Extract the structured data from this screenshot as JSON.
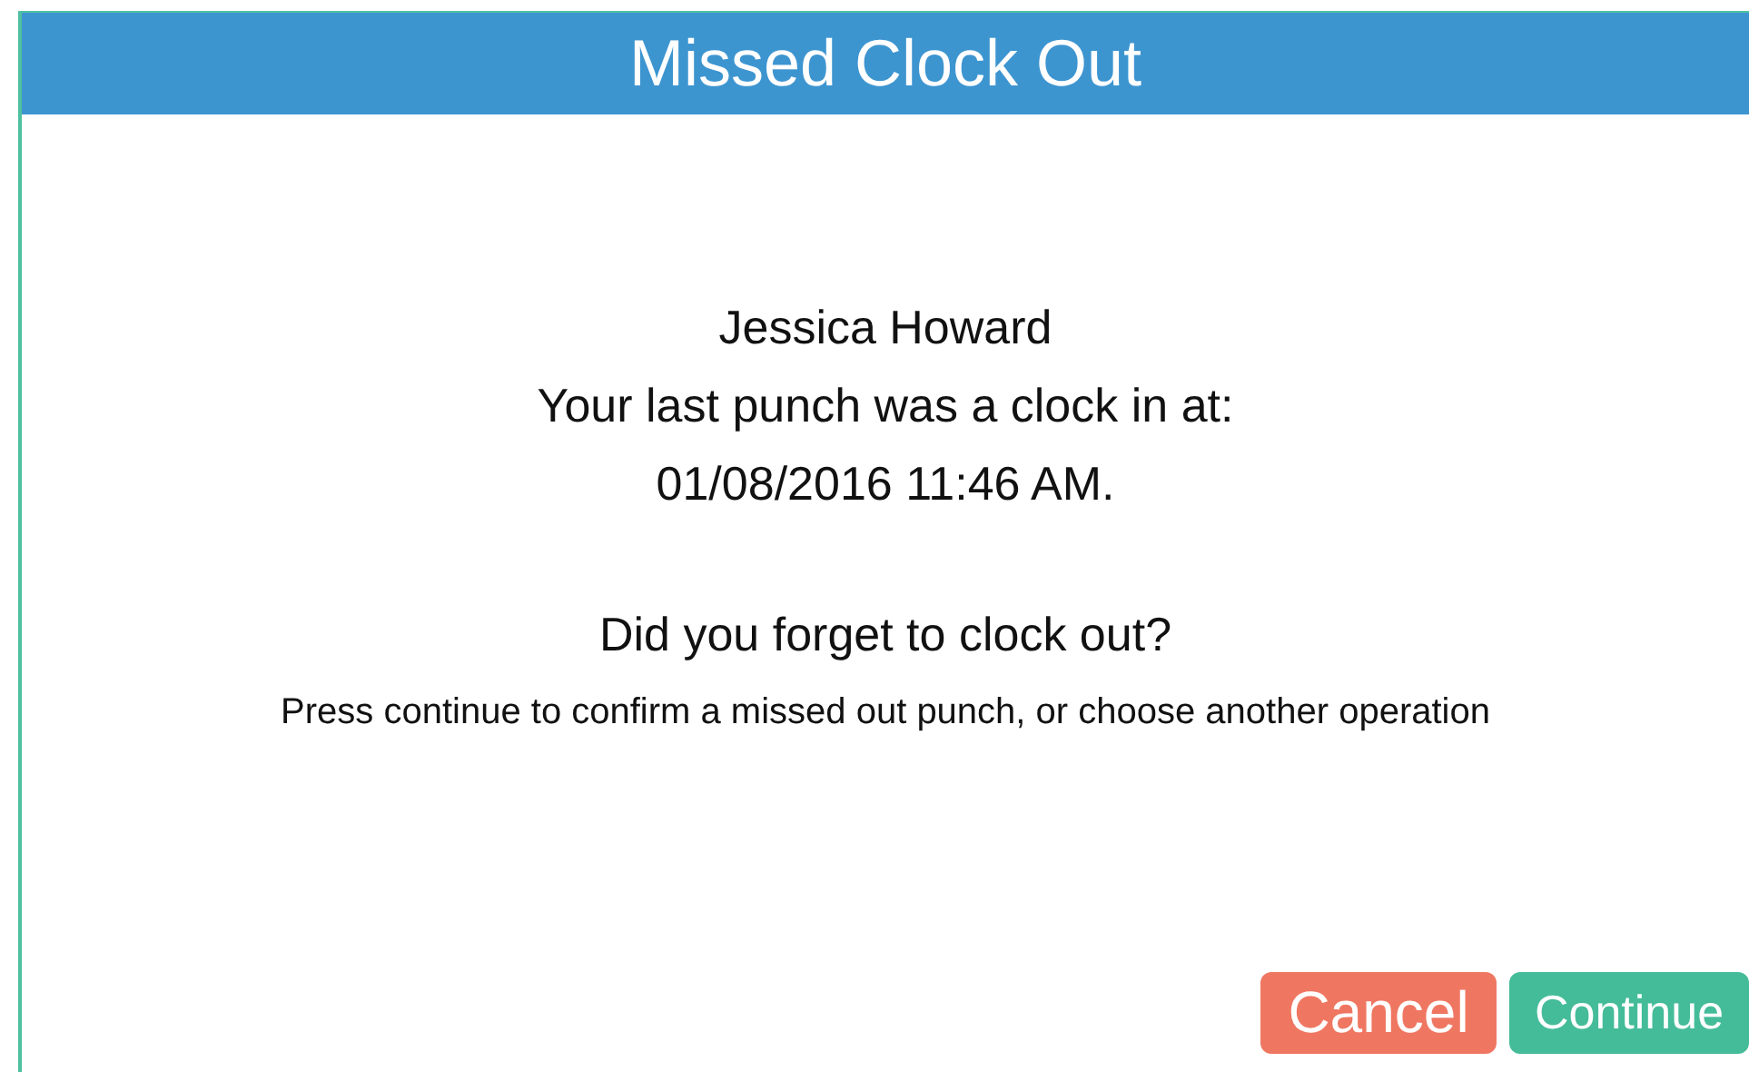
{
  "dialog": {
    "title": "Missed Clock Out",
    "employee": "Jessica Howard",
    "last_punch": "Your last punch was a clock in at:",
    "punch_time": "01/08/2016 11:46 AM.",
    "question": "Did you forget to clock out?",
    "instructions": "Press continue to confirm a missed out punch, or choose another operation",
    "buttons": [
      {
        "label": "Cancel",
        "kind": "cancel"
      },
      {
        "label": "Continue",
        "kind": "confirm"
      }
    ]
  }
}
